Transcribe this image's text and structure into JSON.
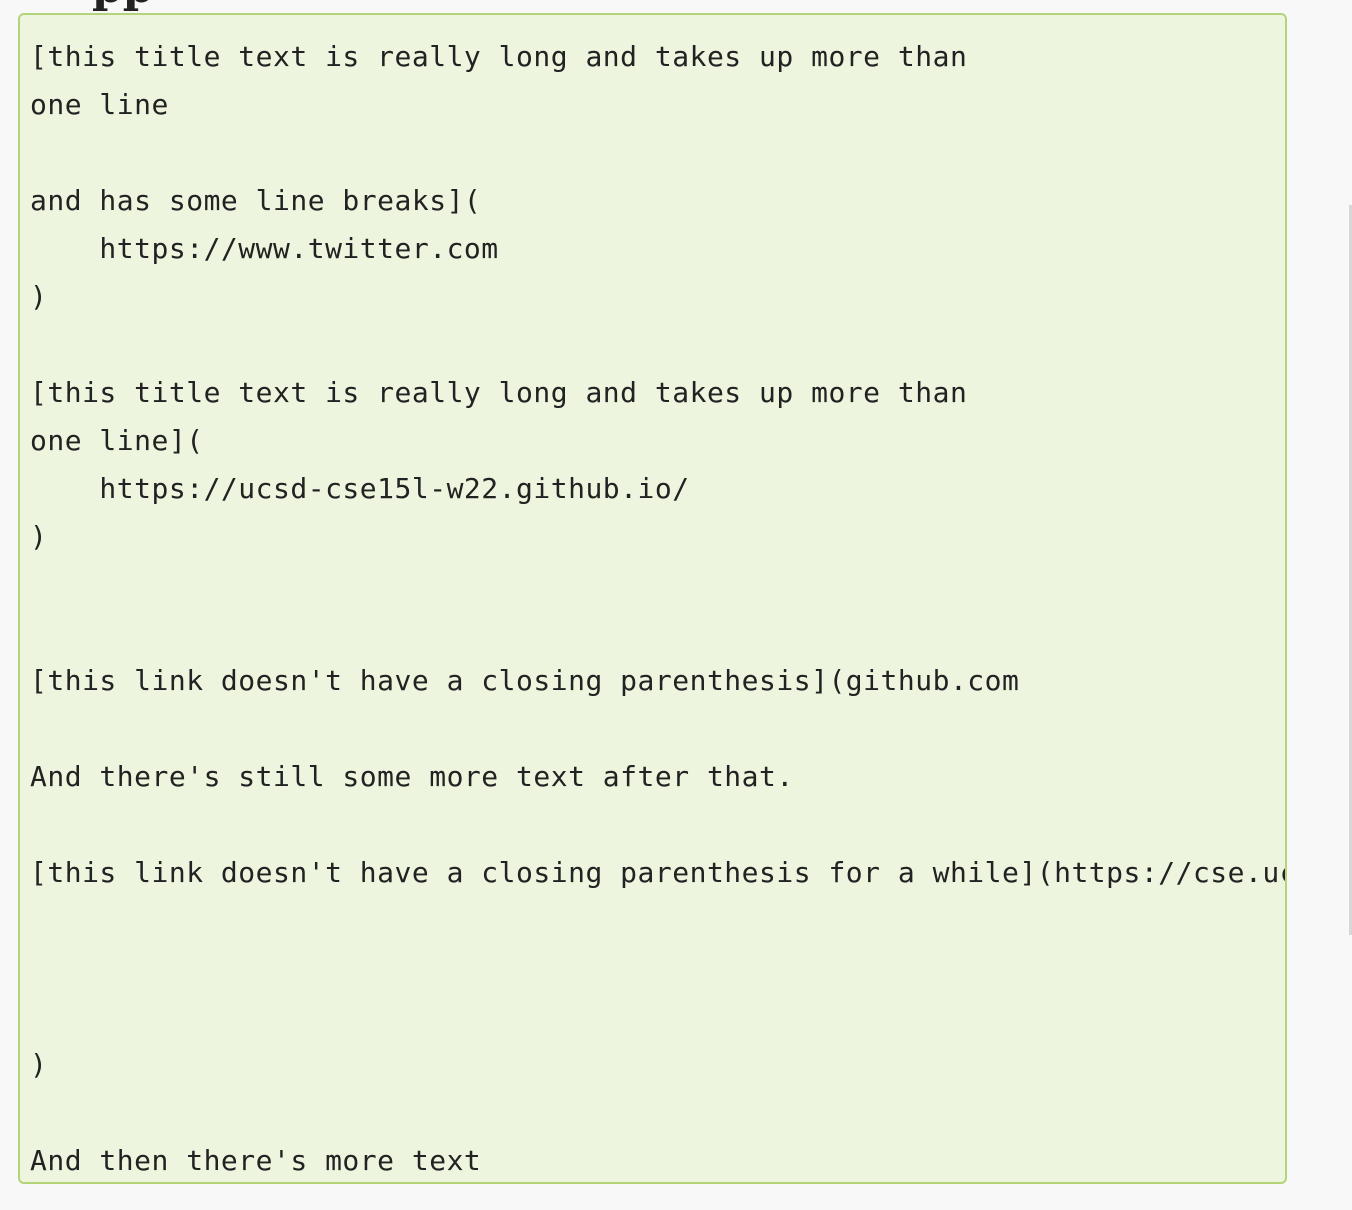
{
  "page": {
    "heading_fragment": "pp"
  },
  "code_block": {
    "content": "[this title text is really long and takes up more than\none line\n\nand has some line breaks](\n    https://www.twitter.com\n)\n\n[this title text is really long and takes up more than\none line](\n    https://ucsd-cse15l-w22.github.io/\n)\n\n\n[this link doesn't have a closing parenthesis](github.com\n\nAnd there's still some more text after that.\n\n[this link doesn't have a closing parenthesis for a while](https://cse.ucsd.edu/\n\n\n\n)\n\nAnd then there's more text"
  },
  "colors": {
    "panel_background": "#eef5de",
    "panel_border": "#b4d47a",
    "text": "#222222",
    "page_background": "#f8f8f8"
  }
}
